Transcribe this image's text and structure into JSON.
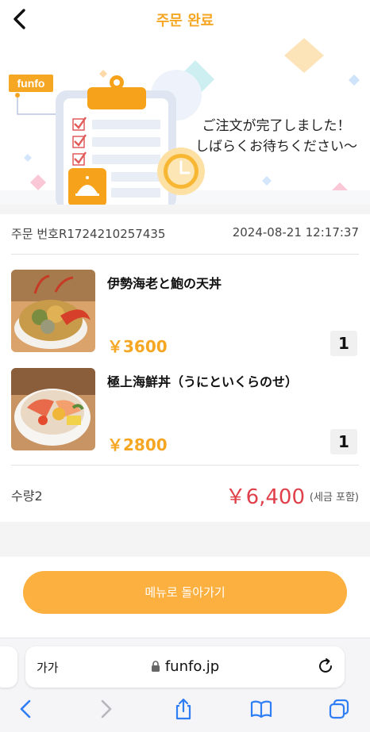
{
  "header": {
    "title": "주문 완료"
  },
  "hero": {
    "brand": "funfo",
    "message_line1": "ご注文が完了しました！",
    "message_line2": "しばらくお待ちください〜"
  },
  "order": {
    "number_label": "주문 번호R1724210257435",
    "datetime": "2024-08-21 12:17:37"
  },
  "items": [
    {
      "name": "伊勢海老と鮑の天丼",
      "price": "￥3600",
      "qty": "1"
    },
    {
      "name": "極上海鮮丼（うにといくらのせ）",
      "price": "￥2800",
      "qty": "1"
    }
  ],
  "summary": {
    "quantity": "수량2",
    "total": "￥6,400",
    "tax_note": "(세금 포함)"
  },
  "cta": {
    "label": "메뉴로 돌아가기"
  },
  "browser": {
    "text_size_label": "가가",
    "url": "funfo.jp"
  },
  "colors": {
    "accent": "#f5a623",
    "total": "#e0404a",
    "button": "#fcb040"
  }
}
